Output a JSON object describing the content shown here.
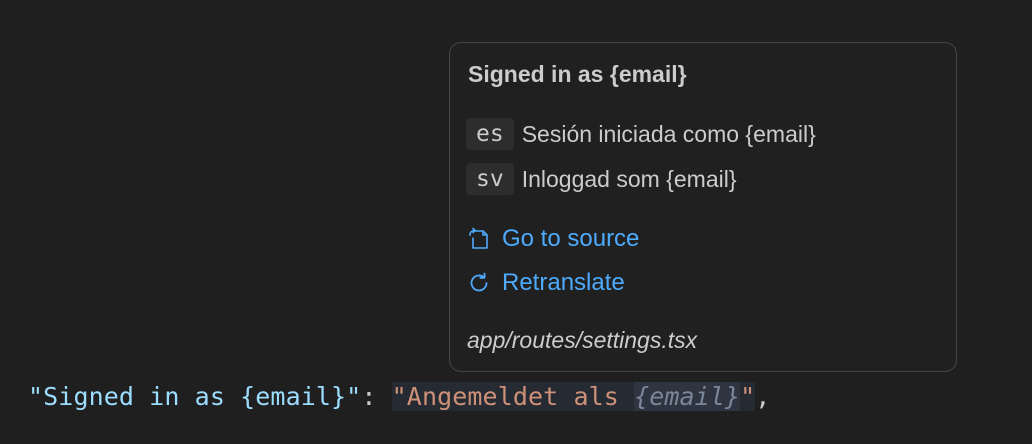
{
  "editor": {
    "code_line": {
      "key_text": "\"Signed in as {email}\"",
      "separator": ": ",
      "value_prefix": "\"Angemeldet als ",
      "value_placeholder": "{email}",
      "value_suffix": "\"",
      "trailing": ","
    }
  },
  "hover": {
    "title": "Signed in as {email}",
    "translations": [
      {
        "lang": "es",
        "text": "Sesión iniciada como {email}"
      },
      {
        "lang": "sv",
        "text": "Inloggad som {email}"
      }
    ],
    "actions": {
      "go_to_source": {
        "label": "Go to source",
        "icon": "go-to-file-icon"
      },
      "retranslate": {
        "label": "Retranslate",
        "icon": "refresh-icon"
      }
    },
    "file_path": "app/routes/settings.tsx"
  },
  "colors": {
    "background": "#1f1f1f",
    "link": "#4daafc",
    "json_key": "#9cdcfe",
    "json_string": "#ce9178"
  }
}
